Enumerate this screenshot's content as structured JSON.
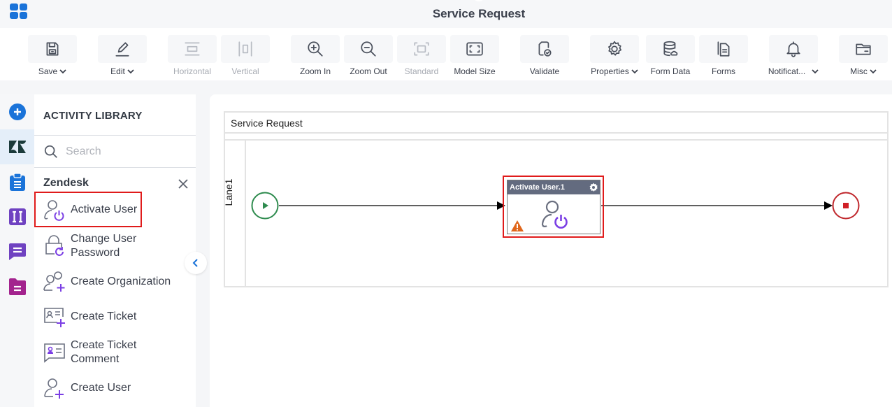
{
  "header": {
    "title": "Service Request",
    "app_menu_icon": "app-grid-icon"
  },
  "toolbar": {
    "buttons": [
      {
        "id": "save",
        "label": "Save",
        "icon": "save-icon",
        "dropdown": true,
        "enabled": true
      },
      {
        "id": "edit",
        "label": "Edit",
        "icon": "pencil-icon",
        "dropdown": true,
        "enabled": true
      },
      {
        "id": "horizontal",
        "label": "Horizontal",
        "icon": "horizontal-layout-icon",
        "dropdown": false,
        "enabled": false
      },
      {
        "id": "vertical",
        "label": "Vertical",
        "icon": "vertical-layout-icon",
        "dropdown": false,
        "enabled": false
      },
      {
        "id": "zoom-in",
        "label": "Zoom In",
        "icon": "zoom-in-icon",
        "dropdown": false,
        "enabled": true
      },
      {
        "id": "zoom-out",
        "label": "Zoom Out",
        "icon": "zoom-out-icon",
        "dropdown": false,
        "enabled": true
      },
      {
        "id": "standard",
        "label": "Standard",
        "icon": "standard-size-icon",
        "dropdown": false,
        "enabled": false
      },
      {
        "id": "model-size",
        "label": "Model Size",
        "icon": "fit-screen-icon",
        "dropdown": false,
        "enabled": true
      },
      {
        "id": "validate",
        "label": "Validate",
        "icon": "validate-icon",
        "dropdown": false,
        "enabled": true
      },
      {
        "id": "properties",
        "label": "Properties",
        "icon": "gear-icon",
        "dropdown": true,
        "enabled": true
      },
      {
        "id": "form-data",
        "label": "Form Data",
        "icon": "database-icon",
        "dropdown": false,
        "enabled": true
      },
      {
        "id": "forms",
        "label": "Forms",
        "icon": "forms-icon",
        "dropdown": false,
        "enabled": true
      },
      {
        "id": "notifications",
        "label": "Notificat...",
        "icon": "bell-icon",
        "dropdown": true,
        "enabled": true
      },
      {
        "id": "misc",
        "label": "Misc",
        "icon": "folder-icon",
        "dropdown": true,
        "enabled": true
      }
    ]
  },
  "rail": {
    "items": [
      {
        "name": "add",
        "icon": "add-circle-icon",
        "color": "#1a73d9",
        "active": false
      },
      {
        "name": "zendesk",
        "icon": "zendesk-icon",
        "color": "#1b3a3a",
        "active": true
      },
      {
        "name": "clipboard",
        "icon": "clipboard-icon",
        "color": "#1a73d9",
        "active": false
      },
      {
        "name": "integration",
        "icon": "integration-icon",
        "color": "#6f42c1",
        "active": false
      },
      {
        "name": "chat",
        "icon": "chat-icon",
        "color": "#6f42c1",
        "active": false
      },
      {
        "name": "folder-doc",
        "icon": "document-folder-icon",
        "color": "#a3238e",
        "active": false
      }
    ]
  },
  "library": {
    "title": "ACTIVITY LIBRARY",
    "search_placeholder": "Search",
    "category": "Zendesk",
    "items": [
      {
        "label": "Activate User",
        "icon": "activate-user-icon",
        "selected": true
      },
      {
        "label": "Change User Password",
        "icon": "change-password-icon",
        "selected": false
      },
      {
        "label": "Create Organization",
        "icon": "create-organization-icon",
        "selected": false
      },
      {
        "label": "Create Ticket",
        "icon": "create-ticket-icon",
        "selected": false
      },
      {
        "label": "Create Ticket Comment",
        "icon": "ticket-comment-icon",
        "selected": false
      },
      {
        "label": "Create User",
        "icon": "create-user-icon",
        "selected": false
      }
    ]
  },
  "canvas": {
    "pool_title": "Service Request",
    "lane_label": "Lane1",
    "task": {
      "title": "Activate User.1",
      "warning": true
    },
    "colors": {
      "start": "#2e8b4e",
      "end": "#c0282d",
      "task_header": "#636b7f",
      "selection": "#e01b1b",
      "accent_purple": "#7b3fe4",
      "warning": "#e0661b"
    }
  }
}
